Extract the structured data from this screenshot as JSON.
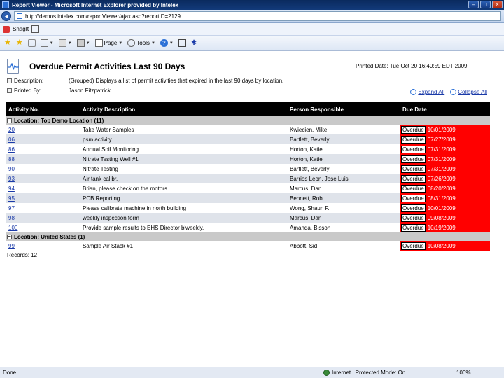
{
  "window": {
    "title": "Report Viewer - Microsoft Internet Explorer provided by Intelex",
    "minimize": "–",
    "maximize": "□",
    "close": "×"
  },
  "address": {
    "url": "http://demos.intelex.com/reportViewer/ajax.asp?reportID=2129"
  },
  "links_bar": {
    "snagit_label": "SnagIt"
  },
  "command_bar": {
    "page_label": "Page",
    "tools_label": "Tools"
  },
  "report": {
    "title": "Overdue Permit Activities Last 90 Days",
    "printed_date": "Printed Date: Tue Oct 20 16:40:59 EDT 2009",
    "description_label": "Description:",
    "description_value": "(Grouped) Displays a list of permit activities that expired in the last 90 days by location.",
    "printed_by_label": "Printed By:",
    "printed_by_value": "Jason Fitzpatrick",
    "expand_all": "Expand All",
    "collapse_all": "Collapse All",
    "columns": [
      "Activity No.",
      "Activity Description",
      "Person Responsible",
      "Due Date"
    ],
    "overdue_label": "Overdue",
    "groups": [
      {
        "label": "Location: Top Demo Location (11)",
        "rows": [
          {
            "no": "20",
            "desc": "Take Water Samples",
            "person": "Kwiecien, Mike",
            "due": "10/01/2009"
          },
          {
            "no": "06",
            "desc": "psm activity",
            "person": "Bartlett, Beverly",
            "due": "07/27/2009"
          },
          {
            "no": "86",
            "desc": "Annual Soil Monitoring",
            "person": "Horton, Katie",
            "due": "07/31/2009"
          },
          {
            "no": "88",
            "desc": "Nitrate Testing Well #1",
            "person": "Horton, Katie",
            "due": "07/31/2009"
          },
          {
            "no": "90",
            "desc": "Nitrate Testing",
            "person": "Bartlett, Beverly",
            "due": "07/31/2009"
          },
          {
            "no": "93",
            "desc": "Air tank calibr.",
            "person": "Barrios Leon, Jose Luis",
            "due": "07/26/2009"
          },
          {
            "no": "94",
            "desc": "Brian, please check on the motors.",
            "person": "Marcus, Dan",
            "due": "08/20/2009"
          },
          {
            "no": "95",
            "desc": "PCB Reporting",
            "person": "Bennett, Rob",
            "due": "08/31/2009"
          },
          {
            "no": "97",
            "desc": "Please calibrate machine in north building",
            "person": "Wong, Shaun F.",
            "due": "10/01/2009"
          },
          {
            "no": "98",
            "desc": "weekly inspection form",
            "person": "Marcus, Dan",
            "due": "09/08/2009"
          },
          {
            "no": "100",
            "desc": "Provide sample results to EHS Director biweekly.",
            "person": "Amanda, Bisson",
            "due": "10/19/2009"
          }
        ]
      },
      {
        "label": "Location: United States (1)",
        "rows": [
          {
            "no": "99",
            "desc": "Sample Air Stack #1",
            "person": "Abbott, Sid",
            "due": "10/08/2009"
          }
        ]
      }
    ],
    "records": "Records: 12"
  },
  "status": {
    "done": "Done",
    "zone": "Internet | Protected Mode: On",
    "zoom": "100%"
  }
}
